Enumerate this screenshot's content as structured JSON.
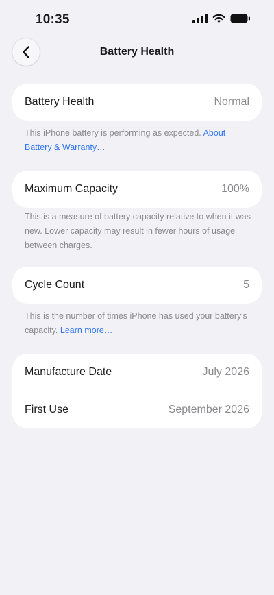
{
  "status_bar": {
    "time": "10:35"
  },
  "nav": {
    "title": "Battery Health"
  },
  "battery_health": {
    "label": "Battery Health",
    "value": "Normal",
    "footnote_text": "This iPhone battery is performing as expected.",
    "footnote_link": "About Battery & Warranty…"
  },
  "maximum_capacity": {
    "label": "Maximum Capacity",
    "value": "100%",
    "footnote_text": "This is a measure of battery capacity relative to when it was new. Lower capacity may result in fewer hours of usage between charges."
  },
  "cycle_count": {
    "label": "Cycle Count",
    "value": "5",
    "footnote_text": "This is the number of times iPhone has used your battery's capacity.",
    "footnote_link": "Learn more…"
  },
  "dates": {
    "manufacture_label": "Manufacture Date",
    "manufacture_value": "July 2026",
    "first_use_label": "First Use",
    "first_use_value": "September 2026"
  },
  "icons": {
    "back": "chevron-left-icon",
    "signal": "cellular-signal-icon",
    "wifi": "wifi-icon",
    "battery": "battery-icon"
  },
  "colors": {
    "background": "#f1f1f6",
    "card": "#ffffff",
    "secondary_text": "#8a8a8e",
    "link": "#3478f6"
  }
}
